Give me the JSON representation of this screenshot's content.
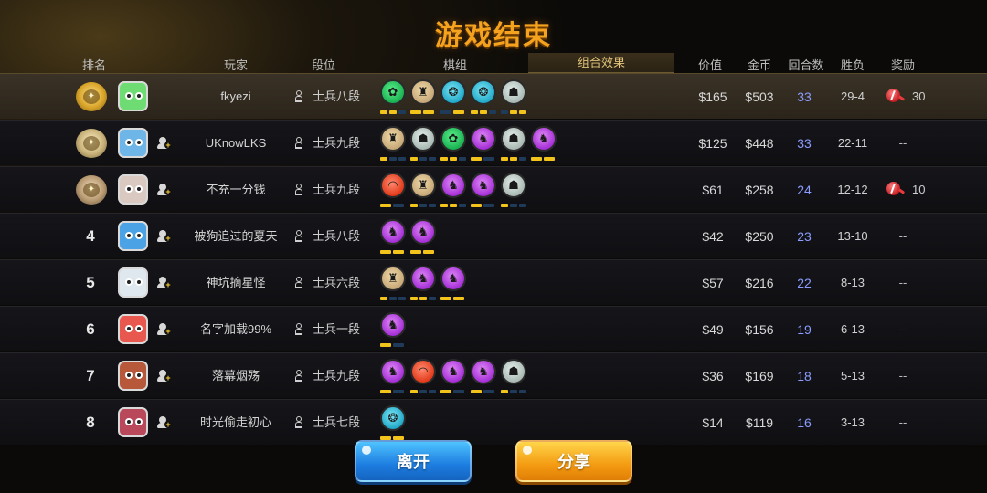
{
  "title": "游戏结束",
  "header": {
    "rank": "排名",
    "player": "玩家",
    "tier": "段位",
    "board": "棋组",
    "synergy": "组合效果",
    "value": "价值",
    "gold": "金币",
    "rounds": "回合数",
    "winloss": "胜负",
    "reward": "奖励"
  },
  "players": [
    {
      "rank": "",
      "medal": "gold",
      "name": "fkyezi",
      "tier": "士兵八段",
      "value": "$165",
      "gold": "$503",
      "rounds": "33",
      "wl": "29-4",
      "reward": "30",
      "has_reward_icon": true,
      "synergies": [
        "green",
        "gold",
        "blue",
        "blue",
        "silver"
      ],
      "bars": [
        [
          1,
          1,
          0
        ],
        [
          1,
          1
        ],
        [
          0,
          1
        ],
        [
          1,
          1,
          0
        ],
        [
          0,
          1,
          1
        ]
      ],
      "avatar": "#6fdc73",
      "highlight": true
    },
    {
      "rank": "",
      "medal": "silver",
      "name": "UKnowLKS",
      "tier": "士兵九段",
      "value": "$125",
      "gold": "$448",
      "rounds": "33",
      "wl": "22-11",
      "reward": "--",
      "has_reward_icon": false,
      "synergies": [
        "gold",
        "silver",
        "green",
        "purple",
        "silver",
        "purple"
      ],
      "bars": [
        [
          1,
          0,
          0
        ],
        [
          1,
          0,
          0
        ],
        [
          1,
          1,
          0
        ],
        [
          1,
          0
        ],
        [
          1,
          1,
          0
        ],
        [
          1,
          1
        ]
      ],
      "avatar": "#6fb6e8",
      "highlight": false
    },
    {
      "rank": "",
      "medal": "bronze",
      "name": "不充一分钱",
      "tier": "士兵九段",
      "value": "$61",
      "gold": "$258",
      "rounds": "24",
      "wl": "12-12",
      "reward": "10",
      "has_reward_icon": true,
      "synergies": [
        "red",
        "gold",
        "purple",
        "purple",
        "silver"
      ],
      "bars": [
        [
          1,
          0
        ],
        [
          1,
          0,
          0
        ],
        [
          1,
          1,
          0
        ],
        [
          1,
          0
        ],
        [
          1,
          0,
          0
        ]
      ],
      "avatar": "#d9c9c0",
      "highlight": false
    },
    {
      "rank": "4",
      "medal": "",
      "name": "被狗追过的夏天",
      "tier": "士兵八段",
      "value": "$42",
      "gold": "$250",
      "rounds": "23",
      "wl": "13-10",
      "reward": "--",
      "has_reward_icon": false,
      "synergies": [
        "purple",
        "purple"
      ],
      "bars": [
        [
          1,
          1
        ],
        [
          1,
          1
        ]
      ],
      "avatar": "#4ba3e6",
      "highlight": false
    },
    {
      "rank": "5",
      "medal": "",
      "name": "神坑摘星怪",
      "tier": "士兵六段",
      "value": "$57",
      "gold": "$216",
      "rounds": "22",
      "wl": "8-13",
      "reward": "--",
      "has_reward_icon": false,
      "synergies": [
        "gold",
        "purple",
        "purple"
      ],
      "bars": [
        [
          1,
          0,
          0
        ],
        [
          1,
          1,
          0
        ],
        [
          1,
          1
        ]
      ],
      "avatar": "#dfe8ee",
      "highlight": false
    },
    {
      "rank": "6",
      "medal": "",
      "name": "名字加载99%",
      "tier": "士兵一段",
      "value": "$49",
      "gold": "$156",
      "rounds": "19",
      "wl": "6-13",
      "reward": "--",
      "has_reward_icon": false,
      "synergies": [
        "purple"
      ],
      "bars": [
        [
          1,
          0
        ]
      ],
      "avatar": "#e8584e",
      "highlight": false
    },
    {
      "rank": "7",
      "medal": "",
      "name": "落幕烟殇",
      "tier": "士兵九段",
      "value": "$36",
      "gold": "$169",
      "rounds": "18",
      "wl": "5-13",
      "reward": "--",
      "has_reward_icon": false,
      "synergies": [
        "purple",
        "red",
        "purple",
        "purple",
        "silver"
      ],
      "bars": [
        [
          1,
          0
        ],
        [
          1,
          0,
          0
        ],
        [
          1,
          0
        ],
        [
          1,
          0
        ],
        [
          1,
          0,
          0
        ]
      ],
      "avatar": "#b8583a",
      "highlight": false
    },
    {
      "rank": "8",
      "medal": "",
      "name": "时光偷走初心",
      "tier": "士兵七段",
      "value": "$14",
      "gold": "$119",
      "rounds": "16",
      "wl": "3-13",
      "reward": "--",
      "has_reward_icon": false,
      "synergies": [
        "blue"
      ],
      "bars": [
        [
          1,
          1
        ]
      ],
      "avatar": "#b8485a",
      "highlight": false
    }
  ],
  "buttons": {
    "leave": "离开",
    "share": "分享"
  }
}
